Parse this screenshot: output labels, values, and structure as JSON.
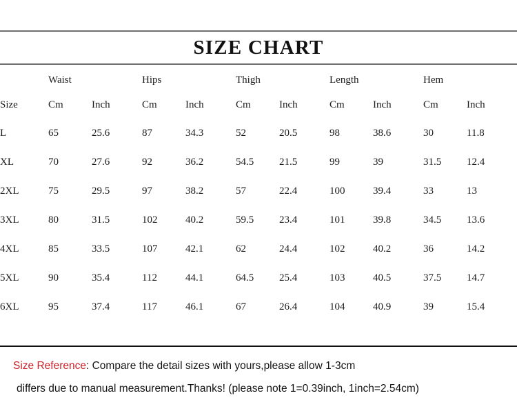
{
  "header": {
    "title": "SIZE CHART"
  },
  "table": {
    "size_column_header": "Size",
    "groups": [
      {
        "label": "Waist"
      },
      {
        "label": "Hips"
      },
      {
        "label": "Thigh"
      },
      {
        "label": "Length"
      },
      {
        "label": "Hem"
      }
    ],
    "unit_headers": [
      "Cm",
      "Inch",
      "Cm",
      "Inch",
      "Cm",
      "Inch",
      "Cm",
      "Inch",
      "Cm",
      "Inch"
    ],
    "rows": [
      {
        "size": "L",
        "values": [
          "65",
          "25.6",
          "87",
          "34.3",
          "52",
          "20.5",
          "98",
          "38.6",
          "30",
          "11.8"
        ]
      },
      {
        "size": "XL",
        "values": [
          "70",
          "27.6",
          "92",
          "36.2",
          "54.5",
          "21.5",
          "99",
          "39",
          "31.5",
          "12.4"
        ]
      },
      {
        "size": "2XL",
        "values": [
          "75",
          "29.5",
          "97",
          "38.2",
          "57",
          "22.4",
          "100",
          "39.4",
          "33",
          "13"
        ]
      },
      {
        "size": "3XL",
        "values": [
          "80",
          "31.5",
          "102",
          "40.2",
          "59.5",
          "23.4",
          "101",
          "39.8",
          "34.5",
          "13.6"
        ]
      },
      {
        "size": "4XL",
        "values": [
          "85",
          "33.5",
          "107",
          "42.1",
          "62",
          "24.4",
          "102",
          "40.2",
          "36",
          "14.2"
        ]
      },
      {
        "size": "5XL",
        "values": [
          "90",
          "35.4",
          "112",
          "44.1",
          "64.5",
          "25.4",
          "103",
          "40.5",
          "37.5",
          "14.7"
        ]
      },
      {
        "size": "6XL",
        "values": [
          "95",
          "37.4",
          "117",
          "46.1",
          "67",
          "26.4",
          "104",
          "40.9",
          "39",
          "15.4"
        ]
      }
    ]
  },
  "footer": {
    "reference_label": "Size Reference",
    "line1_rest": ": Compare the detail sizes with yours,please allow 1-3cm",
    "line2": "differs due to manual measurement.Thanks! (please note 1=0.39inch, 1inch=2.54cm)"
  },
  "colors": {
    "reference_red": "#cc2127",
    "rule_gray": "#6f6f72",
    "rule_black": "#111111",
    "text": "#1a1a1a",
    "background": "#ffffff"
  }
}
